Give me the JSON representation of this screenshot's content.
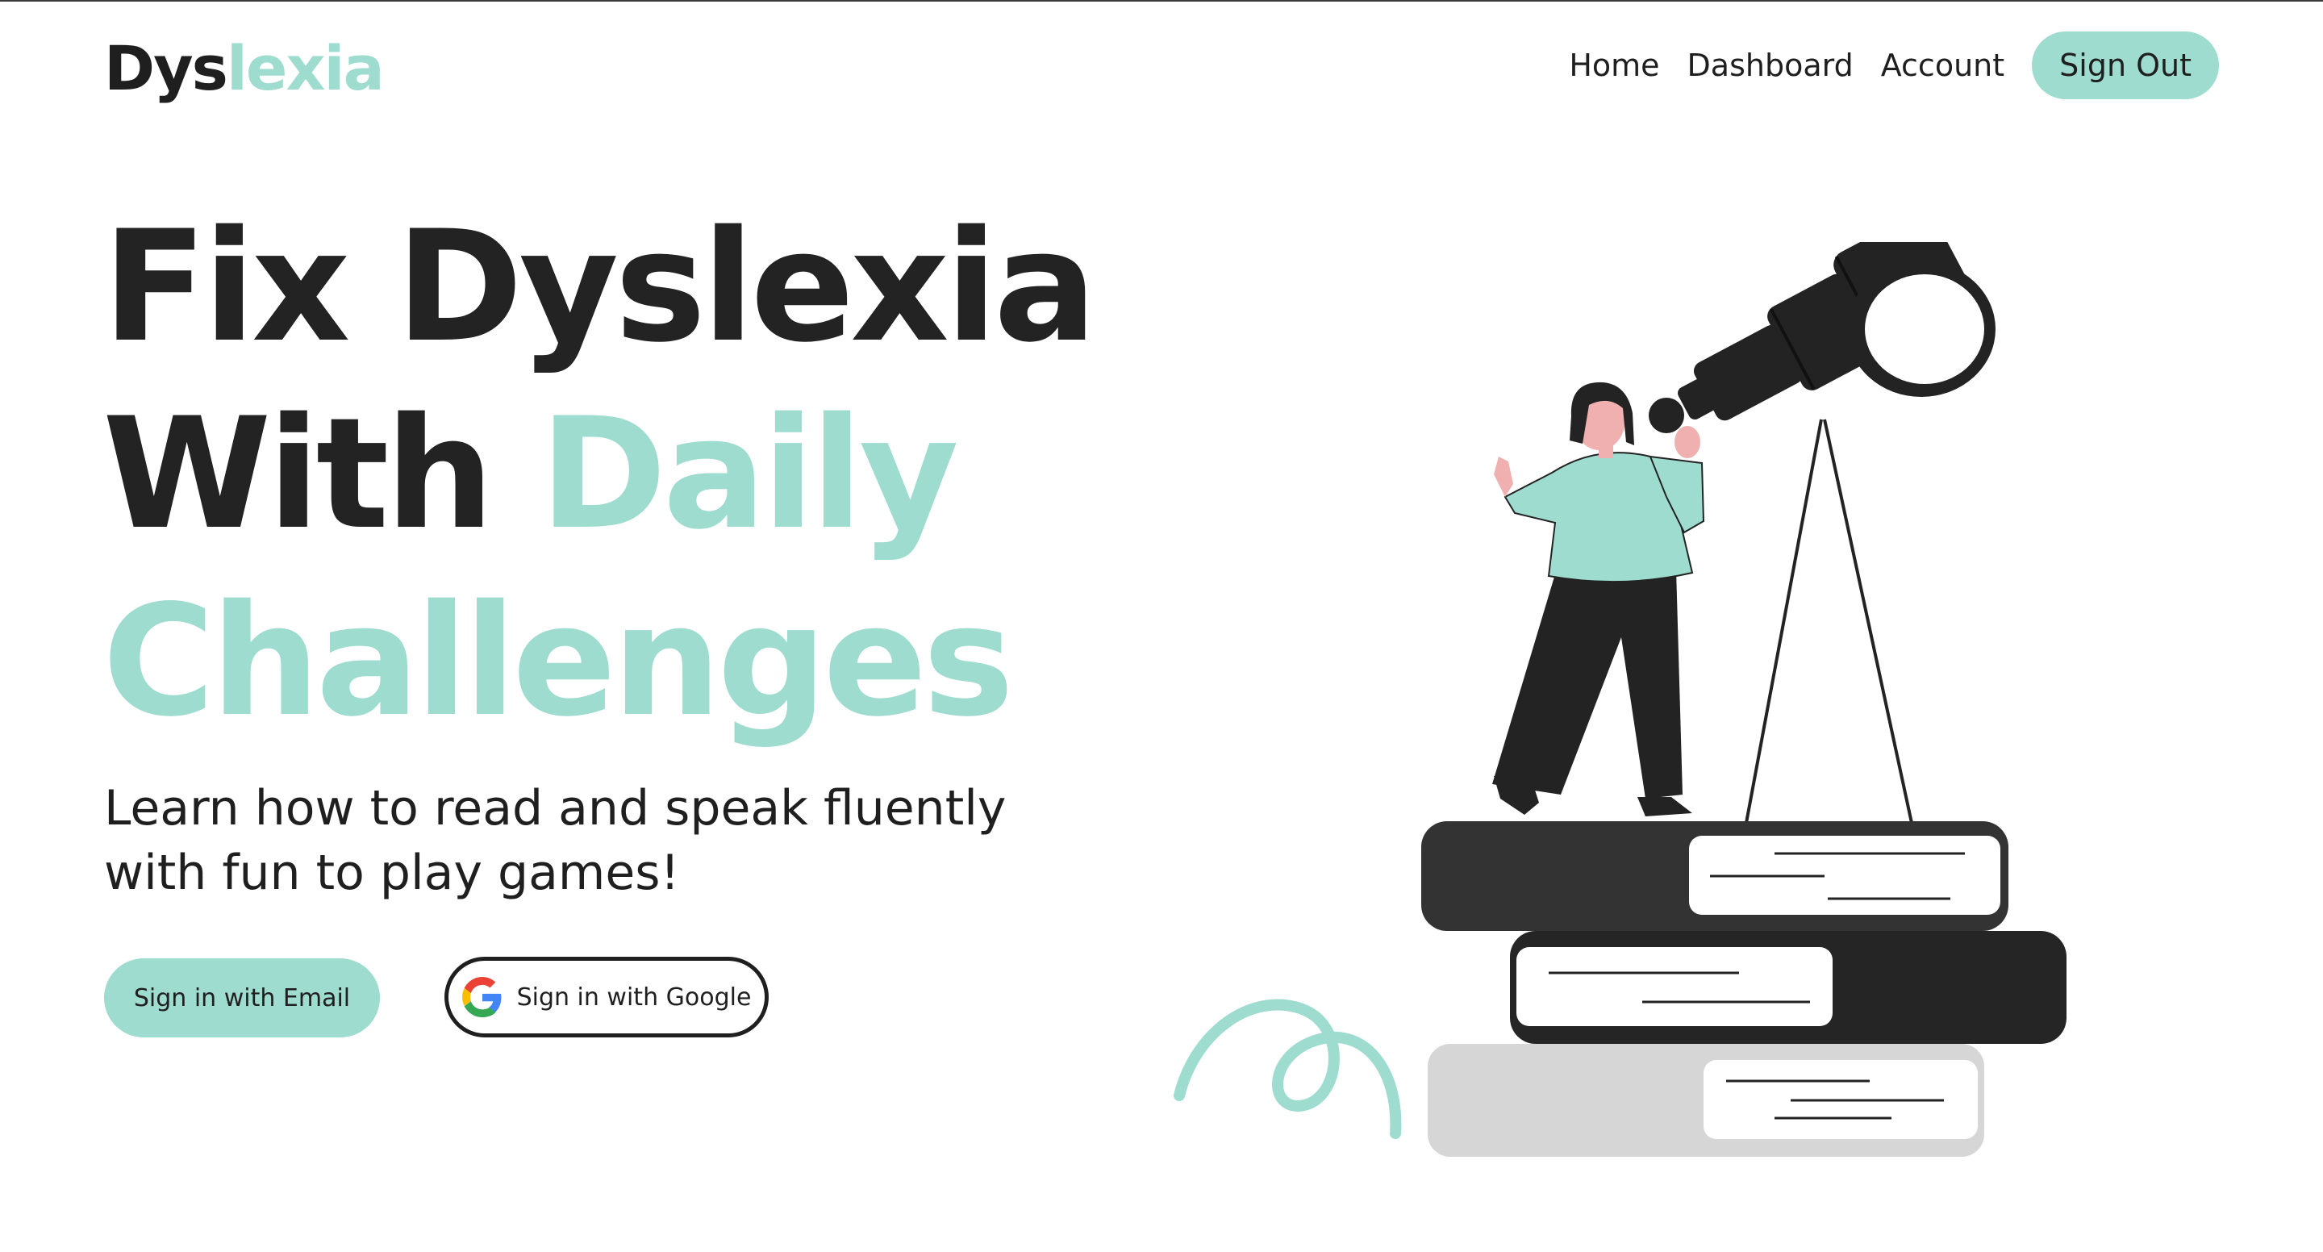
{
  "header": {
    "logo": {
      "part1": "Dys",
      "part2": "lexia"
    },
    "nav": [
      {
        "label": "Home"
      },
      {
        "label": "Dashboard"
      },
      {
        "label": "Account"
      }
    ],
    "sign_out_label": "Sign Out"
  },
  "hero": {
    "line1": "Fix Dyslexia",
    "line2_dark": "With",
    "line2_mint": "Daily",
    "line3": "Challenges"
  },
  "subtitle": "Learn how to read and speak fluently with fun to play games!",
  "buttons": {
    "email_label": "Sign in with Email",
    "google_label": "Sign in with Google"
  },
  "colors": {
    "accent": "#9ddccf",
    "text": "#232323",
    "dark_book": "#2b2b2b",
    "light_book": "#d6d6d6"
  },
  "icons": {
    "google": "google-g-icon"
  }
}
